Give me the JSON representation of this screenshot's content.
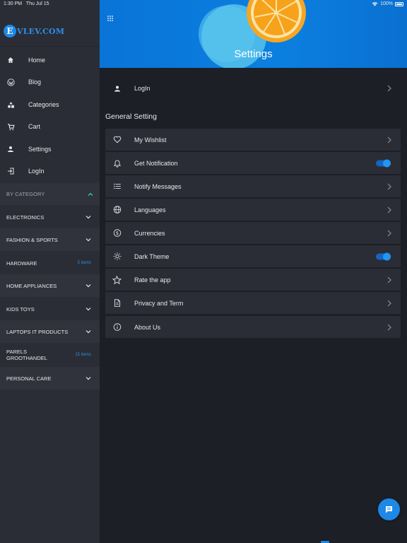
{
  "status_bar": {
    "time": "1:30 PM",
    "date": "Thu Jul 15",
    "battery": "100%"
  },
  "brand": {
    "logo_letter": "E",
    "name": "VLEV.COM",
    "color": "#2f8fe8"
  },
  "nav": [
    {
      "label": "Home",
      "icon": "home-icon"
    },
    {
      "label": "Blog",
      "icon": "wordpress-icon"
    },
    {
      "label": "Categories",
      "icon": "categories-icon"
    },
    {
      "label": "Cart",
      "icon": "cart-icon"
    },
    {
      "label": "Settings",
      "icon": "person-icon"
    },
    {
      "label": "LogIn",
      "icon": "login-icon"
    }
  ],
  "by_category": {
    "label": "BY CATEGORY",
    "accent": "#3ec6c0"
  },
  "categories": [
    {
      "label": "ELECTRONICS",
      "count": ""
    },
    {
      "label": "FASHION & SPORTS",
      "count": ""
    },
    {
      "label": "HARDWARE",
      "count": "5 items"
    },
    {
      "label": "HOME APPLIANCES",
      "count": ""
    },
    {
      "label": "KIDS TOYS",
      "count": ""
    },
    {
      "label": "LAPTOPS IT PRODUCTS",
      "count": ""
    },
    {
      "label": "PARELS GROOTHANDEL",
      "count": "15 items"
    },
    {
      "label": "PERSONAL CARE",
      "count": ""
    }
  ],
  "header": {
    "title": "Settings"
  },
  "login_row": {
    "label": "LogIn",
    "icon": "person-icon"
  },
  "general": {
    "title": "General Setting"
  },
  "settings": [
    {
      "label": "My Wishlist",
      "icon": "heart-icon",
      "control": "chevron"
    },
    {
      "label": "Get Notification",
      "icon": "bell-icon",
      "control": "toggle",
      "on": true
    },
    {
      "label": "Notify Messages",
      "icon": "list-icon",
      "control": "chevron"
    },
    {
      "label": "Languages",
      "icon": "globe-icon",
      "control": "chevron"
    },
    {
      "label": "Currencies",
      "icon": "dollar-icon",
      "control": "chevron"
    },
    {
      "label": "Dark Theme",
      "icon": "sun-icon",
      "control": "toggle",
      "on": true
    },
    {
      "label": "Rate the app",
      "icon": "star-icon",
      "control": "chevron"
    },
    {
      "label": "Privacy and Term",
      "icon": "document-icon",
      "control": "chevron"
    },
    {
      "label": "About Us",
      "icon": "info-icon",
      "control": "chevron"
    }
  ],
  "colors": {
    "accent": "#1e88e5",
    "background": "#1c1f26",
    "panel": "#2a2d35"
  }
}
